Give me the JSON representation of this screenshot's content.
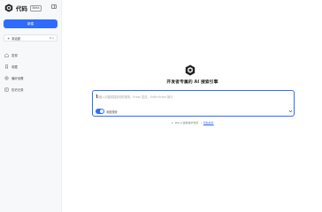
{
  "brand": {
    "name": "代码",
    "badge": "Beta"
  },
  "sidebar": {
    "new_button": "新建",
    "new_search": {
      "label": "新话题",
      "shortcut": "⌘ K"
    },
    "items": [
      {
        "label": "发现",
        "icon": "home-icon"
      },
      {
        "label": "收藏",
        "icon": "bookmark-icon"
      },
      {
        "label": "偏好设置",
        "icon": "settings-icon"
      },
      {
        "label": "历史记录",
        "icon": "history-icon"
      }
    ]
  },
  "main": {
    "title": "开发者专属的 AI 搜索引擎",
    "search": {
      "placeholder": "请输入问题或描述你的需求，Enter 发送，Shift+Enter 换行",
      "toggle_label": "深度搜索",
      "toggle_on": true
    },
    "footer": {
      "text": "Phind 提供技术支持",
      "link": "隐私协议"
    }
  },
  "colors": {
    "accent": "#2f6bff",
    "sidebar_bg": "#f7f8fa"
  }
}
